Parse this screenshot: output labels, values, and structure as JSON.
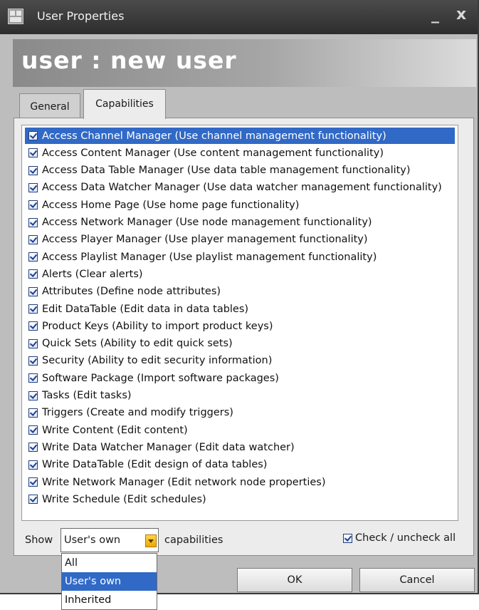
{
  "window": {
    "title": "User Properties",
    "minimize_glyph": "_",
    "close_glyph": "x",
    "header": "user : new user"
  },
  "tabs": [
    {
      "label": "General",
      "active": false
    },
    {
      "label": "Capabilities",
      "active": true
    }
  ],
  "capabilities": {
    "items": [
      {
        "label": "Access Channel Manager (Use channel management functionality)",
        "checked": true,
        "selected": true
      },
      {
        "label": "Access Content Manager (Use content management functionality)",
        "checked": true
      },
      {
        "label": "Access Data Table Manager (Use data table management functionality)",
        "checked": true
      },
      {
        "label": "Access Data Watcher Manager (Use data watcher management functionality)",
        "checked": true
      },
      {
        "label": "Access Home Page (Use home page functionality)",
        "checked": true
      },
      {
        "label": "Access Network Manager (Use node management functionality)",
        "checked": true
      },
      {
        "label": "Access Player Manager (Use player management functionality)",
        "checked": true
      },
      {
        "label": "Access Playlist Manager (Use playlist management functionality)",
        "checked": true
      },
      {
        "label": "Alerts (Clear alerts)",
        "checked": true
      },
      {
        "label": "Attributes (Define node attributes)",
        "checked": true
      },
      {
        "label": "Edit DataTable (Edit data in data tables)",
        "checked": true
      },
      {
        "label": "Product Keys (Ability to import product keys)",
        "checked": true
      },
      {
        "label": "Quick Sets (Ability to edit quick sets)",
        "checked": true
      },
      {
        "label": "Security (Ability to edit security information)",
        "checked": true
      },
      {
        "label": "Software Package (Import software packages)",
        "checked": true
      },
      {
        "label": "Tasks (Edit tasks)",
        "checked": true
      },
      {
        "label": "Triggers (Create and modify triggers)",
        "checked": true
      },
      {
        "label": "Write Content (Edit content)",
        "checked": true
      },
      {
        "label": "Write Data Watcher Manager (Edit data watcher)",
        "checked": true
      },
      {
        "label": "Write DataTable (Edit design of data tables)",
        "checked": true
      },
      {
        "label": "Write Network Manager (Edit network node properties)",
        "checked": true
      },
      {
        "label": "Write Schedule (Edit schedules)",
        "checked": true
      }
    ]
  },
  "filter": {
    "show_label": "Show",
    "selected": "User's own",
    "suffix": "capabilities",
    "options": [
      "All",
      "User's own",
      "Inherited"
    ],
    "check_all_label": "Check / uncheck all",
    "check_all_checked": true
  },
  "buttons": {
    "ok": "OK",
    "cancel": "Cancel"
  },
  "colors": {
    "selection": "#3169c6",
    "titlebar": "#2d2d2d",
    "dropdown_arrow": "#f0a800"
  }
}
